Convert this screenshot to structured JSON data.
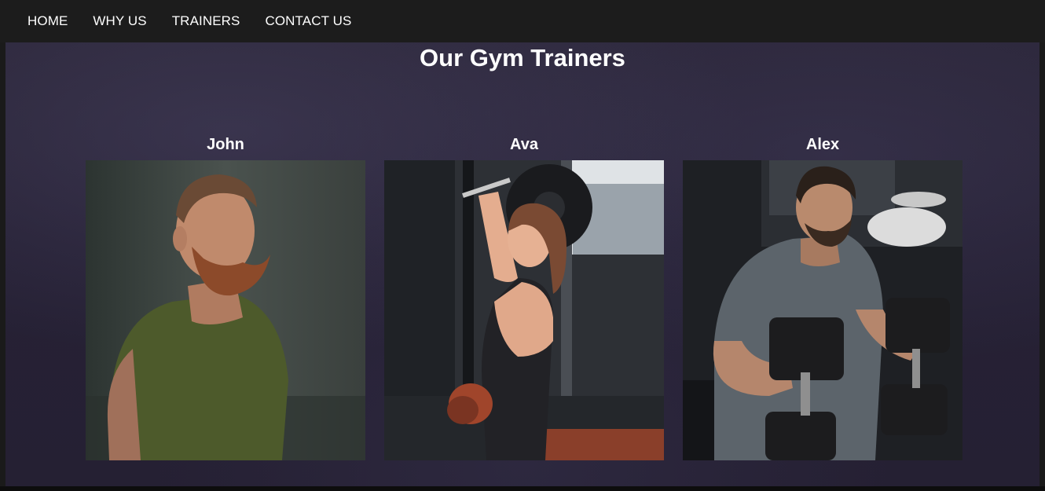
{
  "nav": {
    "items": [
      {
        "label": "HOME"
      },
      {
        "label": "WHY US"
      },
      {
        "label": "TRAINERS"
      },
      {
        "label": "CONTACT US"
      }
    ]
  },
  "section": {
    "title": "Our Gym Trainers"
  },
  "trainers": [
    {
      "name": "John"
    },
    {
      "name": "Ava"
    },
    {
      "name": "Alex"
    }
  ],
  "colors": {
    "navbar": "#1c1c1c",
    "section_bg": "#262135",
    "text": "#ffffff"
  }
}
